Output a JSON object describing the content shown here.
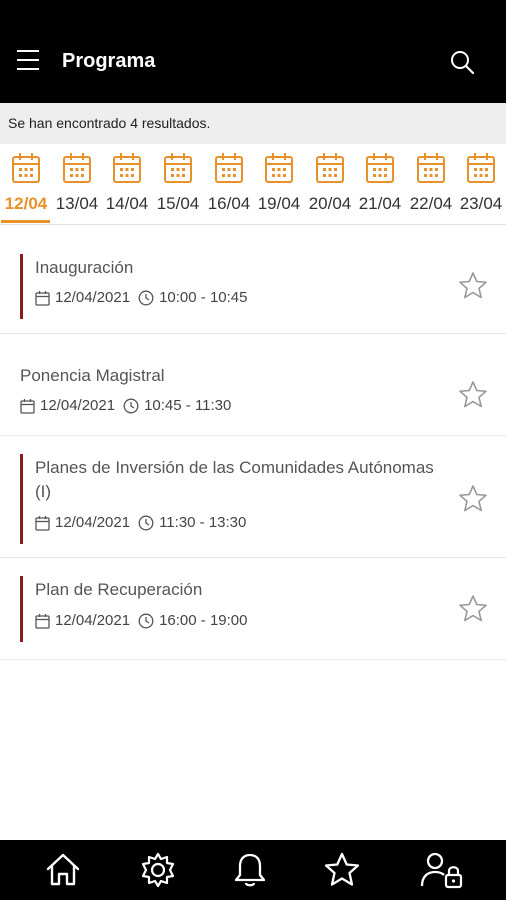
{
  "header": {
    "title": "Programa",
    "menu_icon": "hamburger-menu-icon",
    "search_icon": "search-icon"
  },
  "results_text": "Se han encontrado 4 resultados.",
  "colors": {
    "accent": "#e8912a",
    "marker": "#8b1a1a",
    "appbar": "#000000"
  },
  "dates": [
    {
      "label": "12/04",
      "active": true
    },
    {
      "label": "13/04"
    },
    {
      "label": "14/04"
    },
    {
      "label": "15/04"
    },
    {
      "label": "16/04"
    },
    {
      "label": "19/04"
    },
    {
      "label": "20/04"
    },
    {
      "label": "21/04"
    },
    {
      "label": "22/04"
    },
    {
      "label": "23/04"
    }
  ],
  "sessions": [
    {
      "title": "Inauguración",
      "date": "12/04/2021",
      "time": "10:00 - 10:45"
    },
    {
      "title": "Ponencia Magistral",
      "date": "12/04/2021",
      "time": "10:45 - 11:30"
    },
    {
      "title": "Planes de Inversión de las Comunidades Autónomas (I)",
      "date": "12/04/2021",
      "time": "11:30 - 13:30"
    },
    {
      "title": "Plan de Recuperación",
      "date": "12/04/2021",
      "time": "16:00 - 19:00"
    }
  ],
  "bottom_nav": [
    "home-icon",
    "settings-icon",
    "bell-icon",
    "star-icon",
    "user-lock-icon"
  ]
}
